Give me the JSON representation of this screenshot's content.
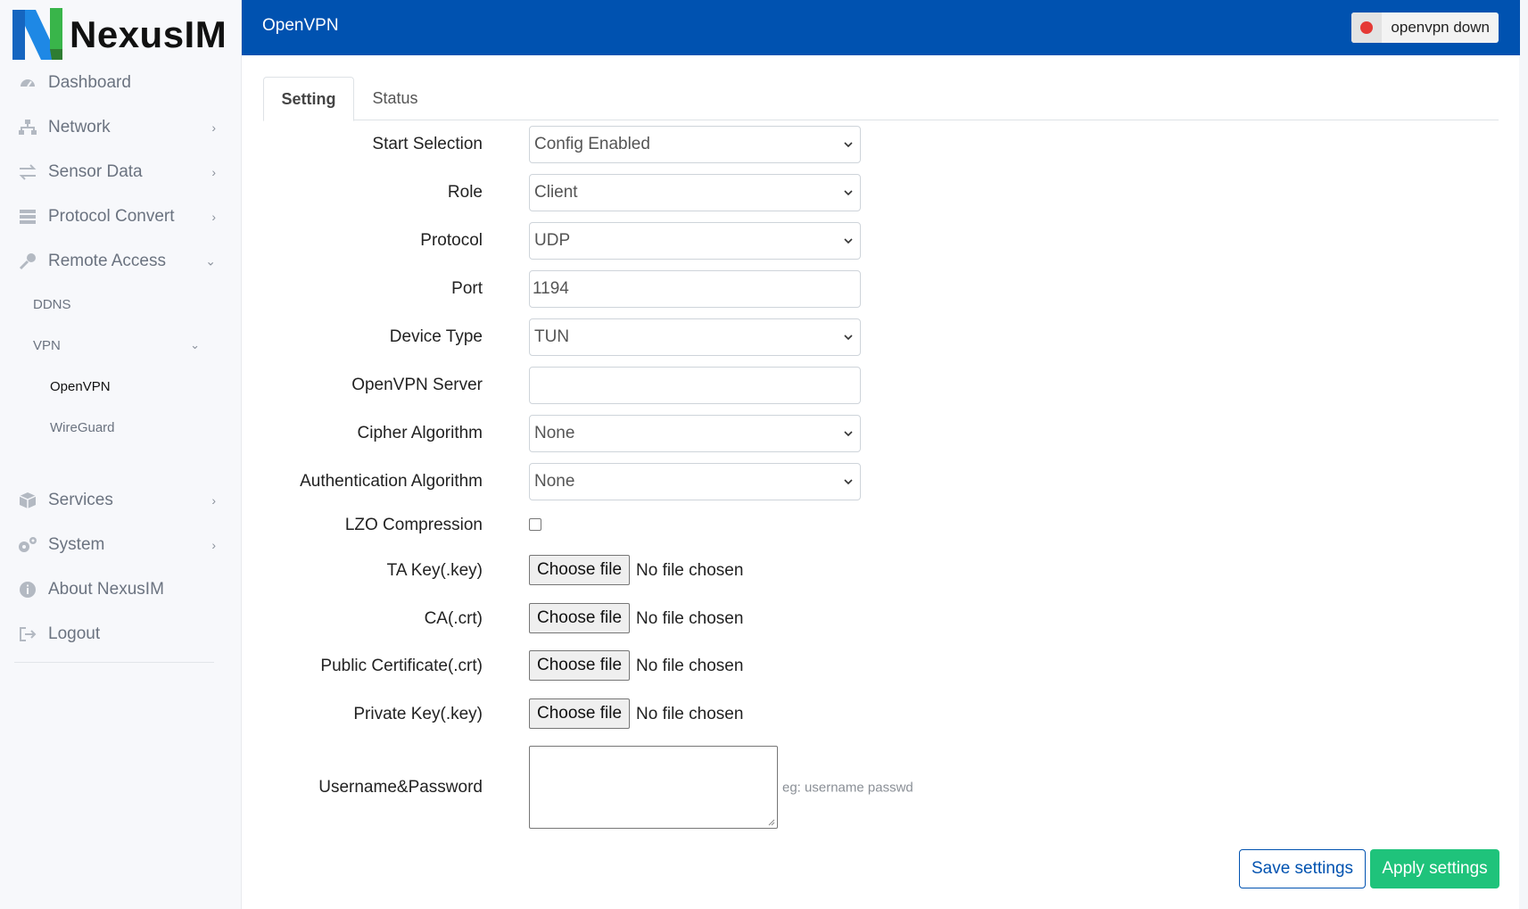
{
  "brand": {
    "name": "NexusIM",
    "colors": {
      "primary": "#0052b0",
      "accent_green": "#1fc37b",
      "status_red": "#e53935"
    }
  },
  "sidebar": {
    "items": [
      {
        "label": "Dashboard",
        "icon": "dashboard-icon"
      },
      {
        "label": "Network",
        "icon": "network-icon",
        "chevron": "right"
      },
      {
        "label": "Sensor Data",
        "icon": "exchange-icon",
        "chevron": "right"
      },
      {
        "label": "Protocol Convert",
        "icon": "server-icon",
        "chevron": "right"
      },
      {
        "label": "Remote Access",
        "icon": "key-icon",
        "chevron": "down"
      },
      {
        "label": "Services",
        "icon": "cube-icon",
        "chevron": "right"
      },
      {
        "label": "System",
        "icon": "gears-icon",
        "chevron": "right"
      },
      {
        "label": "About NexusIM",
        "icon": "info-icon"
      },
      {
        "label": "Logout",
        "icon": "logout-icon"
      }
    ],
    "remote_access_sub": [
      {
        "label": "DDNS"
      },
      {
        "label": "VPN",
        "chevron": "down"
      }
    ],
    "vpn_sub": [
      {
        "label": "OpenVPN",
        "active": true
      },
      {
        "label": "WireGuard"
      }
    ]
  },
  "header": {
    "title": "OpenVPN",
    "status": "openvpn down"
  },
  "tabs": [
    {
      "label": "Setting",
      "active": true
    },
    {
      "label": "Status"
    }
  ],
  "form": {
    "start_selection": {
      "label": "Start Selection",
      "value": "Config Enabled"
    },
    "role": {
      "label": "Role",
      "value": "Client"
    },
    "protocol": {
      "label": "Protocol",
      "value": "UDP"
    },
    "port": {
      "label": "Port",
      "value": "1194"
    },
    "device_type": {
      "label": "Device Type",
      "value": "TUN"
    },
    "openvpn_server": {
      "label": "OpenVPN Server",
      "value": ""
    },
    "cipher": {
      "label": "Cipher Algorithm",
      "value": "None"
    },
    "auth": {
      "label": "Authentication Algorithm",
      "value": "None"
    },
    "lzo": {
      "label": "LZO Compression",
      "checked": false
    },
    "ta_key": {
      "label": "TA Key(.key)",
      "button": "Choose file",
      "status": "No file chosen"
    },
    "ca": {
      "label": "CA(.crt)",
      "button": "Choose file",
      "status": "No file chosen"
    },
    "public_cert": {
      "label": "Public Certificate(.crt)",
      "button": "Choose file",
      "status": "No file chosen"
    },
    "private_key": {
      "label": "Private Key(.key)",
      "button": "Choose file",
      "status": "No file chosen"
    },
    "user_pass": {
      "label": "Username&Password",
      "value": "",
      "hint": "eg: username passwd"
    }
  },
  "actions": {
    "save": "Save settings",
    "apply": "Apply settings"
  }
}
